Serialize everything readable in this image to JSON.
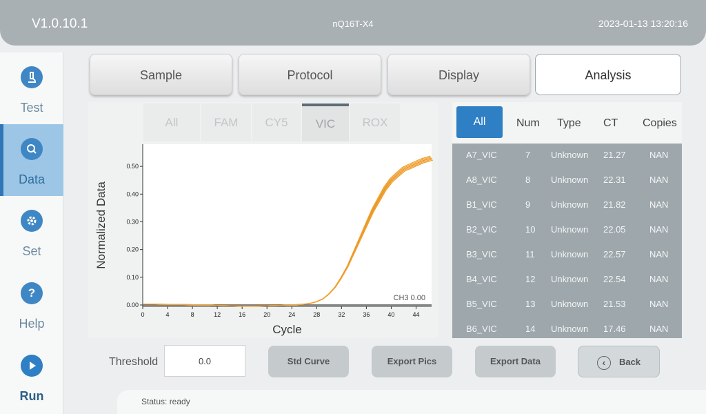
{
  "header": {
    "version": "V1.0.10.1",
    "model": "nQ16T-X4",
    "datetime": "2023-01-13 13:20:16"
  },
  "sidebar": {
    "items": [
      {
        "label": "Test",
        "icon": "microscope-icon"
      },
      {
        "label": "Data",
        "icon": "search-icon"
      },
      {
        "label": "Set",
        "icon": "gear-icon"
      },
      {
        "label": "Help",
        "icon": "question-icon"
      },
      {
        "label": "Run",
        "icon": "play-icon"
      }
    ],
    "active": "Data"
  },
  "tabs": [
    {
      "label": "Sample"
    },
    {
      "label": "Protocol"
    },
    {
      "label": "Display"
    },
    {
      "label": "Analysis"
    }
  ],
  "active_tab": "Analysis",
  "channels": [
    {
      "label": "All"
    },
    {
      "label": "FAM"
    },
    {
      "label": "CY5"
    },
    {
      "label": "VIC"
    },
    {
      "label": "ROX"
    }
  ],
  "active_channel": "VIC",
  "chart_data": {
    "type": "line",
    "xlabel": "Cycle",
    "ylabel": "Normalized Data",
    "xlim": [
      0,
      46.5
    ],
    "ylim": [
      -0.005,
      0.58
    ],
    "xticks": [
      "0",
      "4",
      "8",
      "12",
      "16",
      "20",
      "24",
      "28",
      "32",
      "36",
      "40",
      "44"
    ],
    "yticks": [
      "0.00",
      "0.10",
      "0.20",
      "0.30",
      "0.40",
      "0.50"
    ],
    "threshold_label": "CH3 0.00",
    "threshold_value": 0.0,
    "series_color": "#f0a030",
    "threshold_color": "#555555",
    "curve": {
      "x": [
        0,
        2,
        4,
        6,
        8,
        10,
        12,
        14,
        16,
        18,
        20,
        22,
        24,
        26,
        27,
        28,
        29,
        30,
        31,
        32,
        33,
        34,
        35,
        36,
        37,
        38,
        39,
        40,
        41,
        42,
        43,
        44,
        45,
        46.5
      ],
      "y": [
        0.003,
        0.003,
        0.002,
        0.002,
        0.001,
        0.0,
        -0.002,
        -0.003,
        -0.004,
        -0.004,
        -0.003,
        -0.002,
        0.0,
        0.003,
        0.006,
        0.012,
        0.022,
        0.04,
        0.065,
        0.1,
        0.14,
        0.19,
        0.24,
        0.29,
        0.34,
        0.38,
        0.42,
        0.45,
        0.47,
        0.49,
        0.5,
        0.51,
        0.52,
        0.53
      ]
    }
  },
  "table": {
    "headers": {
      "all": "All",
      "num": "Num",
      "type": "Type",
      "ct": "CT",
      "copies": "Copies"
    },
    "rows": [
      {
        "name": "A7_VIC",
        "num": "7",
        "type": "Unknown",
        "ct": "21.27",
        "copies": "NAN"
      },
      {
        "name": "A8_VIC",
        "num": "8",
        "type": "Unknown",
        "ct": "22.31",
        "copies": "NAN"
      },
      {
        "name": "B1_VIC",
        "num": "9",
        "type": "Unknown",
        "ct": "21.82",
        "copies": "NAN"
      },
      {
        "name": "B2_VIC",
        "num": "10",
        "type": "Unknown",
        "ct": "22.05",
        "copies": "NAN"
      },
      {
        "name": "B3_VIC",
        "num": "11",
        "type": "Unknown",
        "ct": "22.57",
        "copies": "NAN"
      },
      {
        "name": "B4_VIC",
        "num": "12",
        "type": "Unknown",
        "ct": "22.54",
        "copies": "NAN"
      },
      {
        "name": "B5_VIC",
        "num": "13",
        "type": "Unknown",
        "ct": "21.53",
        "copies": "NAN"
      },
      {
        "name": "B6_VIC",
        "num": "14",
        "type": "Unknown",
        "ct": "17.46",
        "copies": "NAN"
      }
    ]
  },
  "threshold": {
    "label": "Threshold",
    "value": "0.0"
  },
  "buttons": {
    "std_curve": "Std Curve",
    "export_pics": "Export Pics",
    "export_data": "Export Data",
    "back": "Back"
  },
  "status": "Status: ready"
}
